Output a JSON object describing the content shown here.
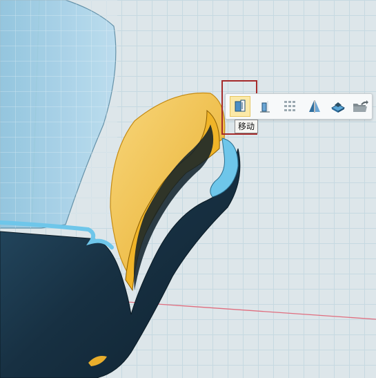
{
  "toolbar": {
    "tools": [
      {
        "id": "move",
        "icon": "move-icon",
        "active": true
      },
      {
        "id": "align",
        "icon": "align-icon",
        "active": false
      },
      {
        "id": "array",
        "icon": "array-icon",
        "active": false
      },
      {
        "id": "mirror",
        "icon": "mirror-icon",
        "active": false
      },
      {
        "id": "place-on-surface",
        "icon": "place-on-surface-icon",
        "active": false
      },
      {
        "id": "export",
        "icon": "export-folder-icon",
        "active": false
      }
    ],
    "tooltip": "移动"
  },
  "colors": {
    "grid_background": "#dde6ea",
    "grid_line": "#c6d9e1",
    "axis_green": "#9fd09a",
    "axis_red": "#e06d7e",
    "model_dark": "#1a3649",
    "model_edge": "#6ec6ea",
    "glass": "#9fcbe3",
    "gold_surface": "#f2c14e",
    "highlight_box": "#a52a2a"
  }
}
